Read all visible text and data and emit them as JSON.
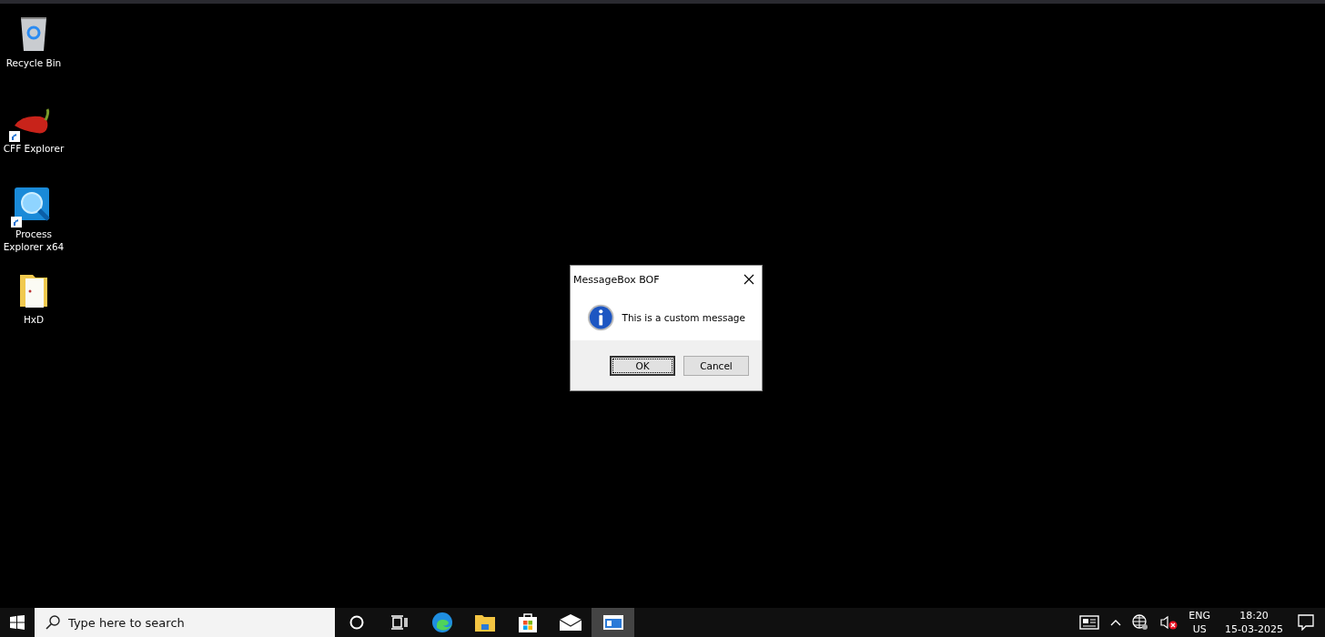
{
  "desktop_icons": [
    {
      "kind": "recycle",
      "label": "Recycle Bin"
    },
    {
      "kind": "pepper",
      "label": "CFF Explorer",
      "shortcut": true
    },
    {
      "kind": "magnifier",
      "label": "Process Explorer x64",
      "shortcut": true
    },
    {
      "kind": "folder",
      "label": "HxD",
      "shortcut": false
    }
  ],
  "dialog": {
    "title": "MessageBox BOF",
    "message": "This is a custom message",
    "buttons": [
      {
        "label": "OK",
        "selected": true
      },
      {
        "label": "Cancel",
        "selected": false
      }
    ]
  },
  "taskbar": {
    "search": {
      "placeholder": "Type here to search"
    },
    "apps": [
      {
        "kind": "cortana",
        "selected": false
      },
      {
        "kind": "taskview",
        "selected": false
      },
      {
        "kind": "edge",
        "selected": false
      },
      {
        "kind": "explorer",
        "selected": false
      },
      {
        "kind": "store",
        "selected": false
      },
      {
        "kind": "mail",
        "selected": false
      },
      {
        "kind": "window",
        "selected": true
      }
    ],
    "tray": {
      "language": "ENG",
      "region": "US",
      "time": "18:20",
      "date": "15-03-2025",
      "sound_muted": true
    }
  }
}
